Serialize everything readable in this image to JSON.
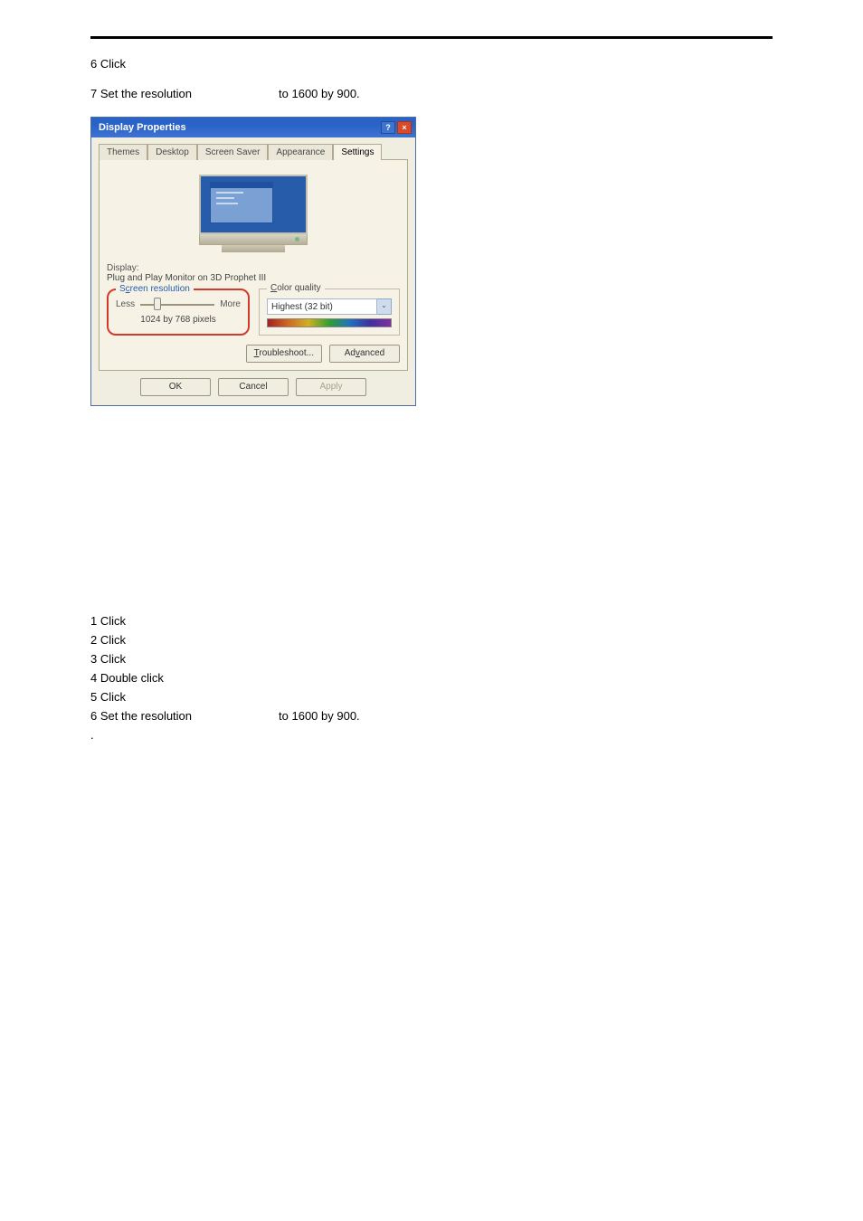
{
  "top_steps": {
    "s6": "6 Click",
    "s7a": "7 Set the resolution",
    "s7b": "to 1600 by 900."
  },
  "dialog": {
    "title": "Display Properties",
    "help": "?",
    "close": "×",
    "tabs": {
      "themes": "Themes",
      "desktop": "Desktop",
      "screensaver": "Screen Saver",
      "appearance": "Appearance",
      "settings": "Settings"
    },
    "display_label": "Display:",
    "display_name": "Plug and Play Monitor on 3D Prophet III",
    "screen_res": {
      "legend_pre": "S",
      "legend_ul": "c",
      "legend_post": "reen resolution",
      "less": "Less",
      "more": "More",
      "value": "1024 by 768 pixels"
    },
    "color_quality": {
      "legend_ul": "C",
      "legend_post": "olor quality",
      "selected": "Highest (32 bit)",
      "caret": "⌄"
    },
    "troubleshoot_ul": "T",
    "troubleshoot_post": "roubleshoot...",
    "advanced_pre": "Ad",
    "advanced_ul": "v",
    "advanced_post": "anced",
    "ok": "OK",
    "cancel": "Cancel",
    "apply": "Apply"
  },
  "lower_steps": {
    "s1": "1 Click",
    "s2": "2 Click",
    "s3": "3 Click",
    "s4": "4 Double click",
    "s5": "5 Click",
    "s6a": "6 Set the resolution",
    "s6b": "to 1600 by 900.",
    "dot": "."
  }
}
